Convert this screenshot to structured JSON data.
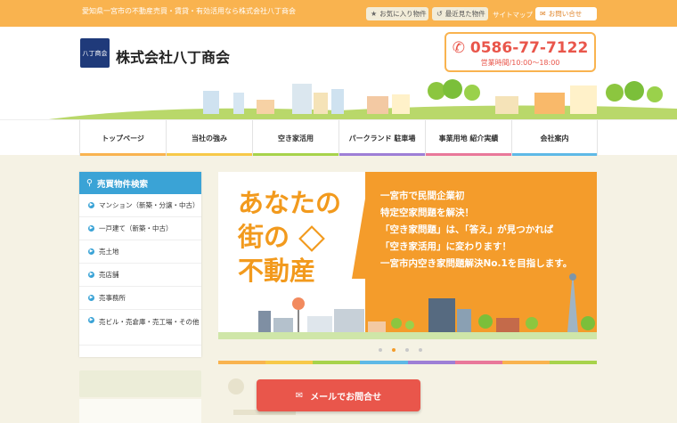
{
  "topbar": {
    "tagline": "愛知県一宮市の不動産売買・賃貸・有効活用なら株式会社八丁商会",
    "favorites_label": "お気に入り物件",
    "recent_label": "最近見た物件",
    "sitemap_label": "サイトマップ",
    "contact_label": "お問い合せ"
  },
  "header": {
    "logo_mark": "八丁商会",
    "company_name": "株式会社八丁商会",
    "phone_number": "0586-77-7122",
    "business_hours": "営業時間/10:00〜18:00"
  },
  "nav": {
    "items": [
      {
        "label": "トップページ",
        "color": "#f9b34f"
      },
      {
        "label": "当社の強み",
        "color": "#f7c948"
      },
      {
        "label": "空き家活用",
        "color": "#a7d34b"
      },
      {
        "label": "パークランド 駐車場",
        "color": "#9e7fd6"
      },
      {
        "label": "事業用地 紹介実績",
        "color": "#e9789a"
      },
      {
        "label": "会社案内",
        "color": "#5eb9e6"
      }
    ]
  },
  "sidebar": {
    "title": "売買物件検索",
    "items": [
      {
        "label": "マンション（新築・分譲・中古）"
      },
      {
        "label": "一戸建て（新築・中古）"
      },
      {
        "label": "売土地"
      },
      {
        "label": "売店舗"
      },
      {
        "label": "売事務所"
      },
      {
        "label": "売ビル・売倉庫・売工場・その他"
      }
    ]
  },
  "hero": {
    "title_lines": [
      "あなたの",
      "街の",
      "不動産"
    ],
    "message_lines": [
      "一宮市で民間企業初",
      "特定空家問題を解決！",
      "「空き家問題」は、「答え」が見つかれば",
      "「空き家活用」に変わります！",
      "一宮市内空き家問題解決No.1を目指します。"
    ],
    "slide_count": 4,
    "active_slide": 2
  },
  "cta": {
    "mail_label": "メールでお問合せ"
  },
  "colors": {
    "primary_orange": "#f9b34f",
    "accent_red": "#e9564b",
    "sidebar_blue": "#3aa3d6"
  }
}
